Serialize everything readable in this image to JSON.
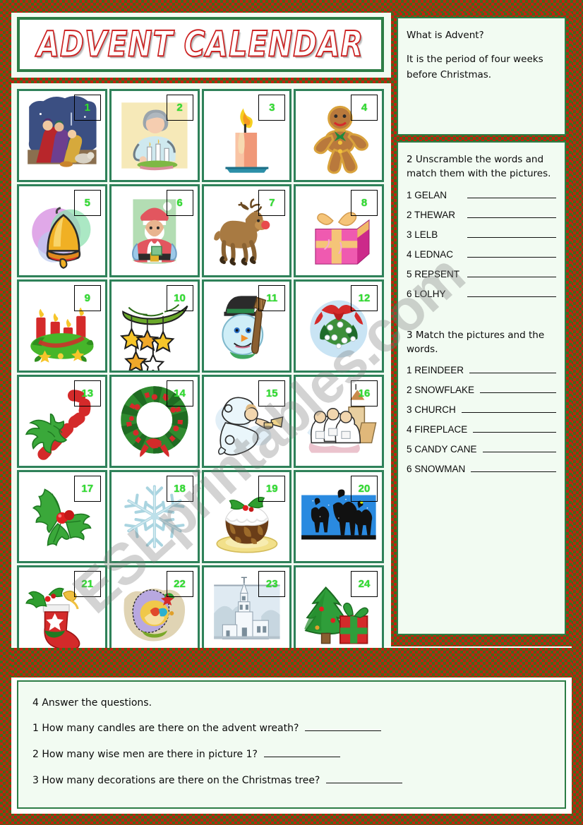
{
  "title": "ADVENT CALENDAR",
  "watermark": "ESLprintables.com",
  "colors": {
    "border_red": "#c3200d",
    "border_green": "#3f6b1e",
    "panel_green": "#2d7d46",
    "cell_green": "#2e8159",
    "number_green": "#33dd33",
    "panel_bg": "#f2fbf2",
    "title_outline": "#cc2222"
  },
  "calendar": {
    "cells": [
      {
        "number": "1",
        "icon": "nativity-wise-men-icon"
      },
      {
        "number": "2",
        "icon": "person-lighting-advent-candles-icon"
      },
      {
        "number": "3",
        "icon": "candle-icon"
      },
      {
        "number": "4",
        "icon": "gingerbread-man-icon"
      },
      {
        "number": "5",
        "icon": "bell-icon"
      },
      {
        "number": "6",
        "icon": "santa-claus-icon"
      },
      {
        "number": "7",
        "icon": "reindeer-icon"
      },
      {
        "number": "8",
        "icon": "gift-box-icon"
      },
      {
        "number": "9",
        "icon": "advent-wreath-icon"
      },
      {
        "number": "10",
        "icon": "garland-with-stars-icon"
      },
      {
        "number": "11",
        "icon": "snowman-icon"
      },
      {
        "number": "12",
        "icon": "mistletoe-bauble-icon"
      },
      {
        "number": "13",
        "icon": "candy-cane-icon"
      },
      {
        "number": "14",
        "icon": "christmas-wreath-icon"
      },
      {
        "number": "15",
        "icon": "angel-with-trumpet-icon"
      },
      {
        "number": "16",
        "icon": "carol-singers-icon"
      },
      {
        "number": "17",
        "icon": "holly-icon"
      },
      {
        "number": "18",
        "icon": "snowflake-icon"
      },
      {
        "number": "19",
        "icon": "christmas-pudding-icon"
      },
      {
        "number": "20",
        "icon": "camels-silhouette-icon"
      },
      {
        "number": "21",
        "icon": "christmas-stocking-icon"
      },
      {
        "number": "22",
        "icon": "nativity-crib-icon"
      },
      {
        "number": "23",
        "icon": "church-icon"
      },
      {
        "number": "24",
        "icon": "christmas-tree-with-gift-icon"
      }
    ]
  },
  "advent_panel": {
    "question": "What is Advent?",
    "answer": "It is the period of four weeks before Christmas."
  },
  "exercise2": {
    "heading": "2 Unscramble the words and match them with the pictures.",
    "items": [
      {
        "label": "1 GELAN",
        "answer": ""
      },
      {
        "label": "2 THEWAR",
        "answer": ""
      },
      {
        "label": "3 LELB",
        "answer": ""
      },
      {
        "label": "4 LEDNAC",
        "answer": ""
      },
      {
        "label": "5 REPSENT",
        "answer": ""
      },
      {
        "label": "6 LOLHY",
        "answer": ""
      }
    ]
  },
  "exercise3": {
    "heading": "3 Match the pictures and the words.",
    "items": [
      {
        "label": "1 REINDEER",
        "answer": ""
      },
      {
        "label": "2 SNOWFLAKE",
        "answer": ""
      },
      {
        "label": "3 CHURCH",
        "answer": ""
      },
      {
        "label": "4 FIREPLACE",
        "answer": ""
      },
      {
        "label": "5 CANDY CANE",
        "answer": ""
      },
      {
        "label": "6 SNOWMAN",
        "answer": ""
      }
    ]
  },
  "exercise4": {
    "heading": "4 Answer the questions.",
    "questions": [
      {
        "text": "1 How many candles are there on the advent wreath?",
        "answer": ""
      },
      {
        "text": "2 How many wise men are there in picture 1?",
        "answer": ""
      },
      {
        "text": "3 How many decorations are there on the Christmas tree?",
        "answer": ""
      }
    ]
  }
}
